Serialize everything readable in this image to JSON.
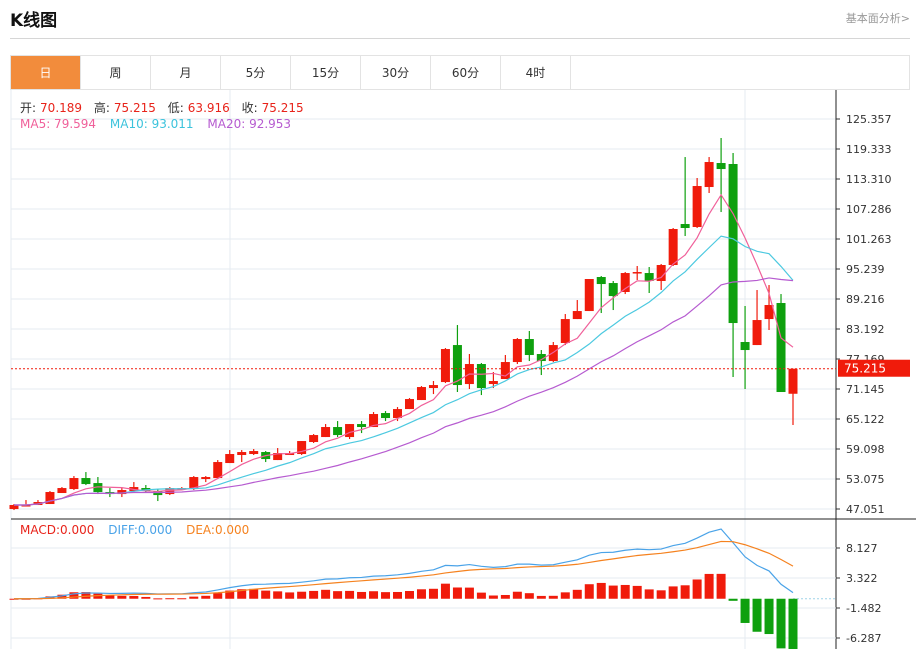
{
  "header": {
    "title": "K线图",
    "link": "基本面分析>"
  },
  "tabs": [
    {
      "label": "日",
      "active": true
    },
    {
      "label": "周"
    },
    {
      "label": "月"
    },
    {
      "label": "5分"
    },
    {
      "label": "15分"
    },
    {
      "label": "30分"
    },
    {
      "label": "60分"
    },
    {
      "label": "4时"
    }
  ],
  "ohlc": {
    "open_label": "开:",
    "open": "70.189",
    "high_label": "高:",
    "high": "75.215",
    "low_label": "低:",
    "low": "63.916",
    "close_label": "收:",
    "close": "75.215"
  },
  "ma": {
    "ma5": "MA5: 79.594",
    "ma10": "MA10: 93.011",
    "ma20": "MA20: 92.953"
  },
  "macd_labels": {
    "macd": "MACD:0.000",
    "diff": "DIFF:0.000",
    "dea": "DEA:0.000"
  },
  "colors": {
    "up": "#f01b0b",
    "down": "#0ea00e",
    "ma5": "#f0609a",
    "ma10": "#4cc9e0",
    "ma20": "#b65bd0",
    "diff": "#4aa3e8",
    "dea": "#f5821f",
    "active_tab": "#f28c3c"
  },
  "chart_data": [
    {
      "type": "candlestick",
      "ylim": [
        47.051,
        125.357
      ],
      "y_ticks": [
        "125.357",
        "119.333",
        "113.310",
        "107.286",
        "101.263",
        "95.239",
        "89.216",
        "83.192",
        "77.169",
        "71.145",
        "65.122",
        "59.098",
        "53.075",
        "47.051"
      ],
      "last_price": "75.215",
      "candles": [
        [
          47.04,
          47.85,
          48.05,
          46.84
        ],
        [
          47.65,
          47.85,
          48.85,
          47.65
        ],
        [
          47.85,
          48.45,
          48.85,
          47.85
        ],
        [
          48.05,
          50.46,
          50.66,
          48.05
        ],
        [
          50.26,
          51.26,
          51.46,
          50.26
        ],
        [
          51.06,
          53.27,
          53.67,
          50.86
        ],
        [
          53.27,
          52.06,
          54.47,
          51.86
        ],
        [
          52.26,
          50.46,
          53.47,
          50.05
        ],
        [
          50.46,
          50.05,
          51.26,
          49.45
        ],
        [
          50.05,
          50.86,
          51.26,
          49.45
        ],
        [
          50.66,
          51.46,
          52.46,
          50.46
        ],
        [
          51.26,
          50.66,
          51.86,
          50.46
        ],
        [
          50.66,
          49.85,
          51.06,
          48.65
        ],
        [
          50.05,
          51.26,
          51.46,
          49.85
        ],
        [
          51.06,
          51.26,
          51.46,
          50.86
        ],
        [
          51.06,
          53.47,
          53.67,
          50.86
        ],
        [
          53.07,
          53.47,
          53.67,
          52.46
        ],
        [
          53.27,
          56.48,
          56.88,
          53.07
        ],
        [
          56.28,
          58.09,
          58.89,
          56.28
        ],
        [
          57.89,
          58.49,
          58.89,
          56.48
        ],
        [
          58.09,
          58.69,
          59.09,
          57.89
        ],
        [
          58.49,
          57.08,
          58.69,
          56.48
        ],
        [
          56.88,
          58.29,
          59.29,
          56.88
        ],
        [
          57.89,
          58.29,
          58.69,
          57.89
        ],
        [
          58.09,
          60.7,
          60.7,
          57.89
        ],
        [
          60.5,
          61.9,
          62.1,
          60.3
        ],
        [
          61.5,
          63.51,
          64.11,
          61.5
        ],
        [
          63.51,
          61.9,
          64.71,
          61.5
        ],
        [
          61.5,
          64.11,
          64.11,
          61.1
        ],
        [
          64.11,
          63.51,
          64.71,
          62.3
        ],
        [
          63.51,
          66.12,
          66.52,
          63.51
        ],
        [
          66.32,
          65.32,
          66.72,
          64.71
        ],
        [
          65.32,
          67.12,
          67.52,
          64.71
        ],
        [
          67.12,
          69.13,
          69.33,
          67.12
        ],
        [
          68.93,
          71.54,
          71.74,
          68.93
        ],
        [
          71.34,
          71.94,
          72.75,
          70.13
        ],
        [
          72.54,
          79.17,
          79.37,
          72.34
        ],
        [
          79.97,
          71.94,
          83.99,
          70.54
        ],
        [
          72.14,
          76.16,
          78.17,
          71.14
        ],
        [
          76.16,
          71.34,
          76.36,
          69.93
        ],
        [
          72.14,
          72.75,
          74.55,
          71.34
        ],
        [
          73.15,
          76.56,
          77.97,
          73.15
        ],
        [
          76.56,
          81.18,
          81.38,
          76.16
        ],
        [
          81.18,
          77.97,
          82.79,
          76.76
        ],
        [
          78.17,
          76.76,
          78.97,
          73.95
        ],
        [
          76.76,
          79.97,
          80.58,
          76.56
        ],
        [
          80.38,
          85.19,
          86.2,
          79.97
        ],
        [
          85.19,
          86.8,
          89.01,
          85.19
        ],
        [
          86.8,
          93.23,
          93.23,
          86.8
        ],
        [
          93.63,
          92.22,
          93.83,
          86.4
        ],
        [
          92.42,
          89.81,
          92.83,
          87.0
        ],
        [
          90.62,
          94.43,
          94.63,
          90.21
        ],
        [
          94.43,
          94.63,
          95.84,
          93.03
        ],
        [
          94.43,
          92.83,
          95.64,
          90.42
        ],
        [
          92.83,
          96.04,
          96.24,
          91.02
        ],
        [
          96.04,
          103.27,
          103.47,
          95.84
        ],
        [
          104.27,
          103.47,
          117.72,
          101.86
        ],
        [
          103.67,
          111.9,
          113.51,
          103.47
        ],
        [
          111.7,
          116.72,
          117.72,
          110.5
        ],
        [
          116.52,
          115.31,
          121.54,
          106.68
        ],
        [
          116.32,
          84.39,
          118.53,
          73.55
        ],
        [
          80.58,
          78.97,
          87.81,
          71.14
        ],
        [
          79.97,
          84.99,
          91.02,
          79.97
        ],
        [
          85.19,
          88.01,
          92.02,
          82.99
        ],
        [
          88.41,
          70.54,
          90.21,
          70.54
        ],
        [
          70.189,
          75.215,
          75.215,
          63.916
        ]
      ],
      "candle_format": [
        "open",
        "close",
        "high",
        "low"
      ],
      "moving_averages": [
        5,
        10,
        20
      ]
    },
    {
      "type": "macd",
      "ylim": [
        -7.5,
        10
      ],
      "y_ticks": [
        "8.127",
        "3.322",
        "-1.482",
        "-6.287"
      ],
      "params": [
        12,
        26,
        9
      ]
    }
  ]
}
